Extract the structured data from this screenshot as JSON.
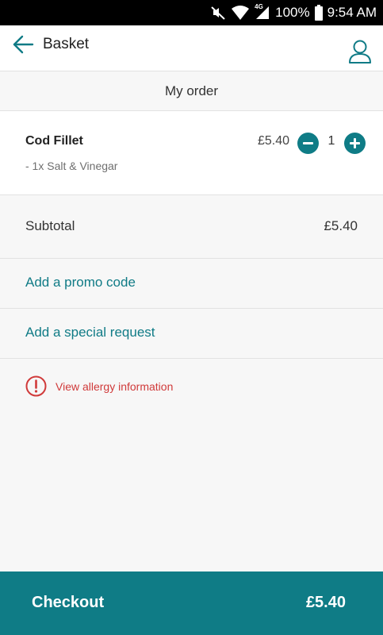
{
  "status_bar": {
    "battery_percent": "100%",
    "time": "9:54 AM",
    "network_label": "4G",
    "icons": [
      "mute-icon",
      "wifi-icon",
      "signal-icon",
      "battery-icon"
    ]
  },
  "app_bar": {
    "title": "Basket",
    "back_icon": "arrow-left-icon",
    "account_icon": "user-icon"
  },
  "section_title": "My order",
  "order_items": [
    {
      "name": "Cod Fillet",
      "modifier": "- 1x Salt & Vinegar",
      "price": "£5.40",
      "quantity": "1"
    }
  ],
  "subtotal": {
    "label": "Subtotal",
    "value": "£5.40"
  },
  "promo": {
    "label": "Add a promo code"
  },
  "special_request": {
    "label": "Add a special request"
  },
  "allergy": {
    "label": "View allergy information",
    "icon": "alert-circle-icon"
  },
  "checkout": {
    "label": "Checkout",
    "total": "£5.40"
  },
  "colors": {
    "accent": "#0f7c86",
    "link": "#107b86",
    "alert": "#d03a3a",
    "background": "#f7f7f7"
  }
}
